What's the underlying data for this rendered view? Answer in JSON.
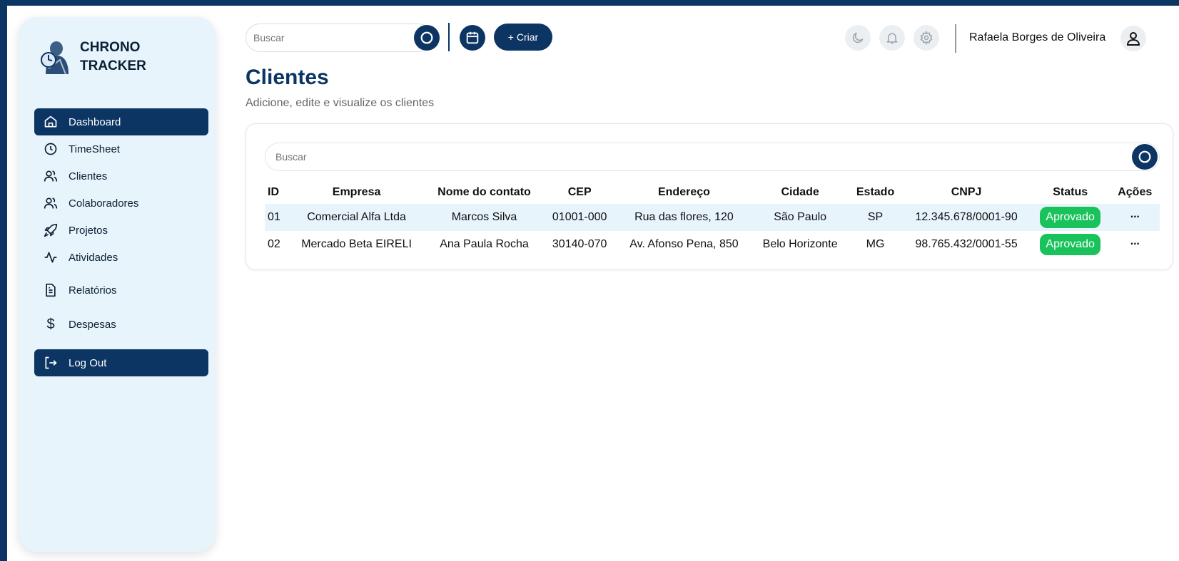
{
  "brand": {
    "line1": "CHRONO",
    "line2": "TRACKER"
  },
  "sidebar": {
    "items": [
      {
        "label": "Dashboard",
        "icon": "home-icon"
      },
      {
        "label": "TimeSheet",
        "icon": "clock-icon"
      },
      {
        "label": "Clientes",
        "icon": "users-icon"
      },
      {
        "label": "Colaboradores",
        "icon": "users-icon"
      },
      {
        "label": "Projetos",
        "icon": "rocket-icon"
      },
      {
        "label": "Atividades",
        "icon": "activity-icon"
      },
      {
        "label": "Relatórios",
        "icon": "file-text-icon"
      },
      {
        "label": "Despesas",
        "icon": "dollar-icon"
      }
    ],
    "logout": "Log Out"
  },
  "topbar": {
    "search_placeholder": "Buscar",
    "create_label": "+ Criar",
    "user_name": "Rafaela Borges de Oliveira"
  },
  "page": {
    "title": "Clientes",
    "subtitle": "Adicione, edite e visualize os clientes"
  },
  "table": {
    "search_placeholder": "Buscar",
    "columns": [
      "ID",
      "Empresa",
      "Nome do contato",
      "CEP",
      "Endereço",
      "Cidade",
      "Estado",
      "CNPJ",
      "Status",
      "Ações"
    ],
    "rows": [
      {
        "id": "01",
        "empresa": "Comercial Alfa Ltda",
        "contato": "Marcos Silva",
        "cep": "01001-000",
        "endereco": "Rua das flores, 120",
        "cidade": "São Paulo",
        "estado": "SP",
        "cnpj": "12.345.678/0001-90",
        "status": "Aprovado",
        "acoes": "···"
      },
      {
        "id": "02",
        "empresa": "Mercado Beta EIRELI",
        "contato": "Ana Paula Rocha",
        "cep": "30140-070",
        "endereco": "Av. Afonso Pena, 850",
        "cidade": "Belo Horizonte",
        "estado": "MG",
        "cnpj": "98.765.432/0001-55",
        "status": "Aprovado",
        "acoes": "···"
      }
    ]
  },
  "colors": {
    "primary": "#0c3563",
    "sidebar_bg": "#e8f4fc",
    "status_green": "#19c25a"
  }
}
